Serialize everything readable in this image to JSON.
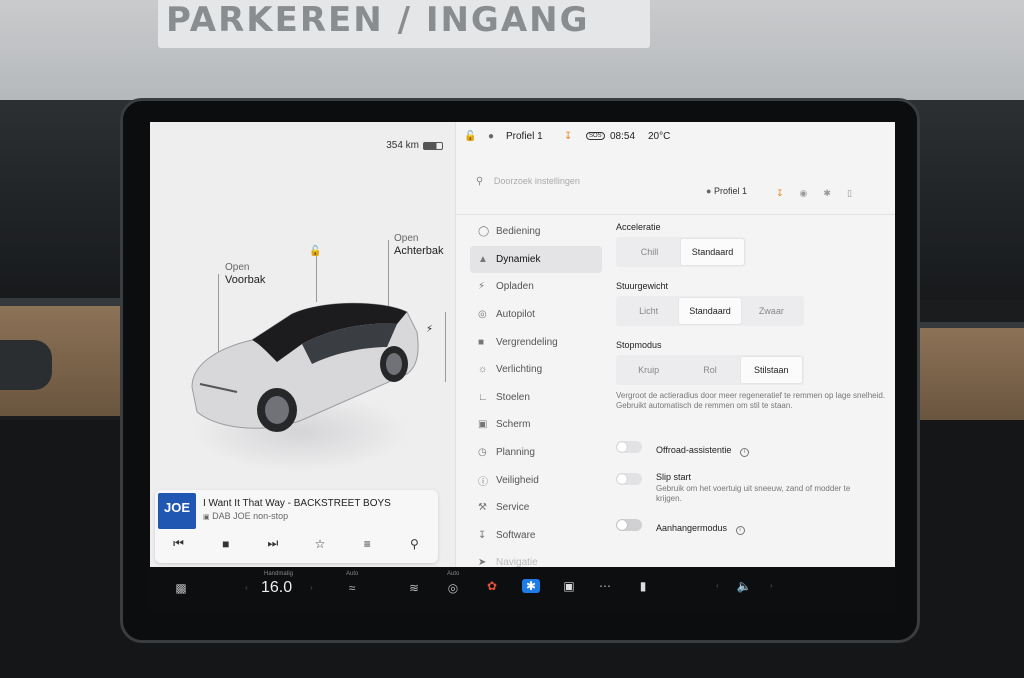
{
  "background": {
    "sign_text": "PARKEREN / INGANG"
  },
  "status": {
    "range": "354 km",
    "profile": "Profiel 1",
    "time": "08:54",
    "temperature": "20°C",
    "sos": "SOS"
  },
  "car_view": {
    "frunk_state": "Open",
    "frunk_label": "Voorbak",
    "trunk_state": "Open",
    "trunk_label": "Achterbak"
  },
  "media": {
    "logo": "JOE",
    "song": "I Want It That Way - BACKSTREET BOYS",
    "station": "DAB JOE non-stop"
  },
  "settings": {
    "search_placeholder": "Doorzoek instellingen",
    "profile": "Profiel 1",
    "menu": [
      {
        "label": "Bediening",
        "icon": "toggle-icon"
      },
      {
        "label": "Dynamiek",
        "icon": "car-icon",
        "active": true
      },
      {
        "label": "Opladen",
        "icon": "bolt-icon"
      },
      {
        "label": "Autopilot",
        "icon": "steering-wheel-icon"
      },
      {
        "label": "Vergrendeling",
        "icon": "lock-icon"
      },
      {
        "label": "Verlichting",
        "icon": "light-icon"
      },
      {
        "label": "Stoelen",
        "icon": "seat-icon"
      },
      {
        "label": "Scherm",
        "icon": "display-icon"
      },
      {
        "label": "Planning",
        "icon": "clock-icon"
      },
      {
        "label": "Veiligheid",
        "icon": "info-icon"
      },
      {
        "label": "Service",
        "icon": "wrench-icon"
      },
      {
        "label": "Software",
        "icon": "download-icon"
      },
      {
        "label": "Navigatie",
        "icon": "navigation-icon"
      }
    ],
    "acceleratie": {
      "title": "Acceleratie",
      "options": [
        "Chill",
        "Standaard"
      ],
      "selected": "Standaard"
    },
    "stuurgewicht": {
      "title": "Stuurgewicht",
      "options": [
        "Licht",
        "Standaard",
        "Zwaar"
      ],
      "selected": "Standaard"
    },
    "stopmodus": {
      "title": "Stopmodus",
      "options": [
        "Kruip",
        "Rol",
        "Stilstaan"
      ],
      "selected": "Stilstaan",
      "description": "Vergroot de actieradius door meer regeneratief te remmen op lage snelheid. Gebruikt automatisch de remmen om stil te staan."
    },
    "offroad": {
      "label": "Offroad-assistentie",
      "enabled": false
    },
    "slip_start": {
      "label": "Slip start",
      "description": "Gebruik om het voertuig uit sneeuw, zand of modder te krijgen.",
      "enabled": false
    },
    "aanhanger": {
      "label": "Aanhangermodus",
      "enabled": false
    }
  },
  "dock": {
    "climate_mode": "Handmatig",
    "temp": "16.0",
    "seat_label": "Auto",
    "wheel_label": "Auto"
  }
}
